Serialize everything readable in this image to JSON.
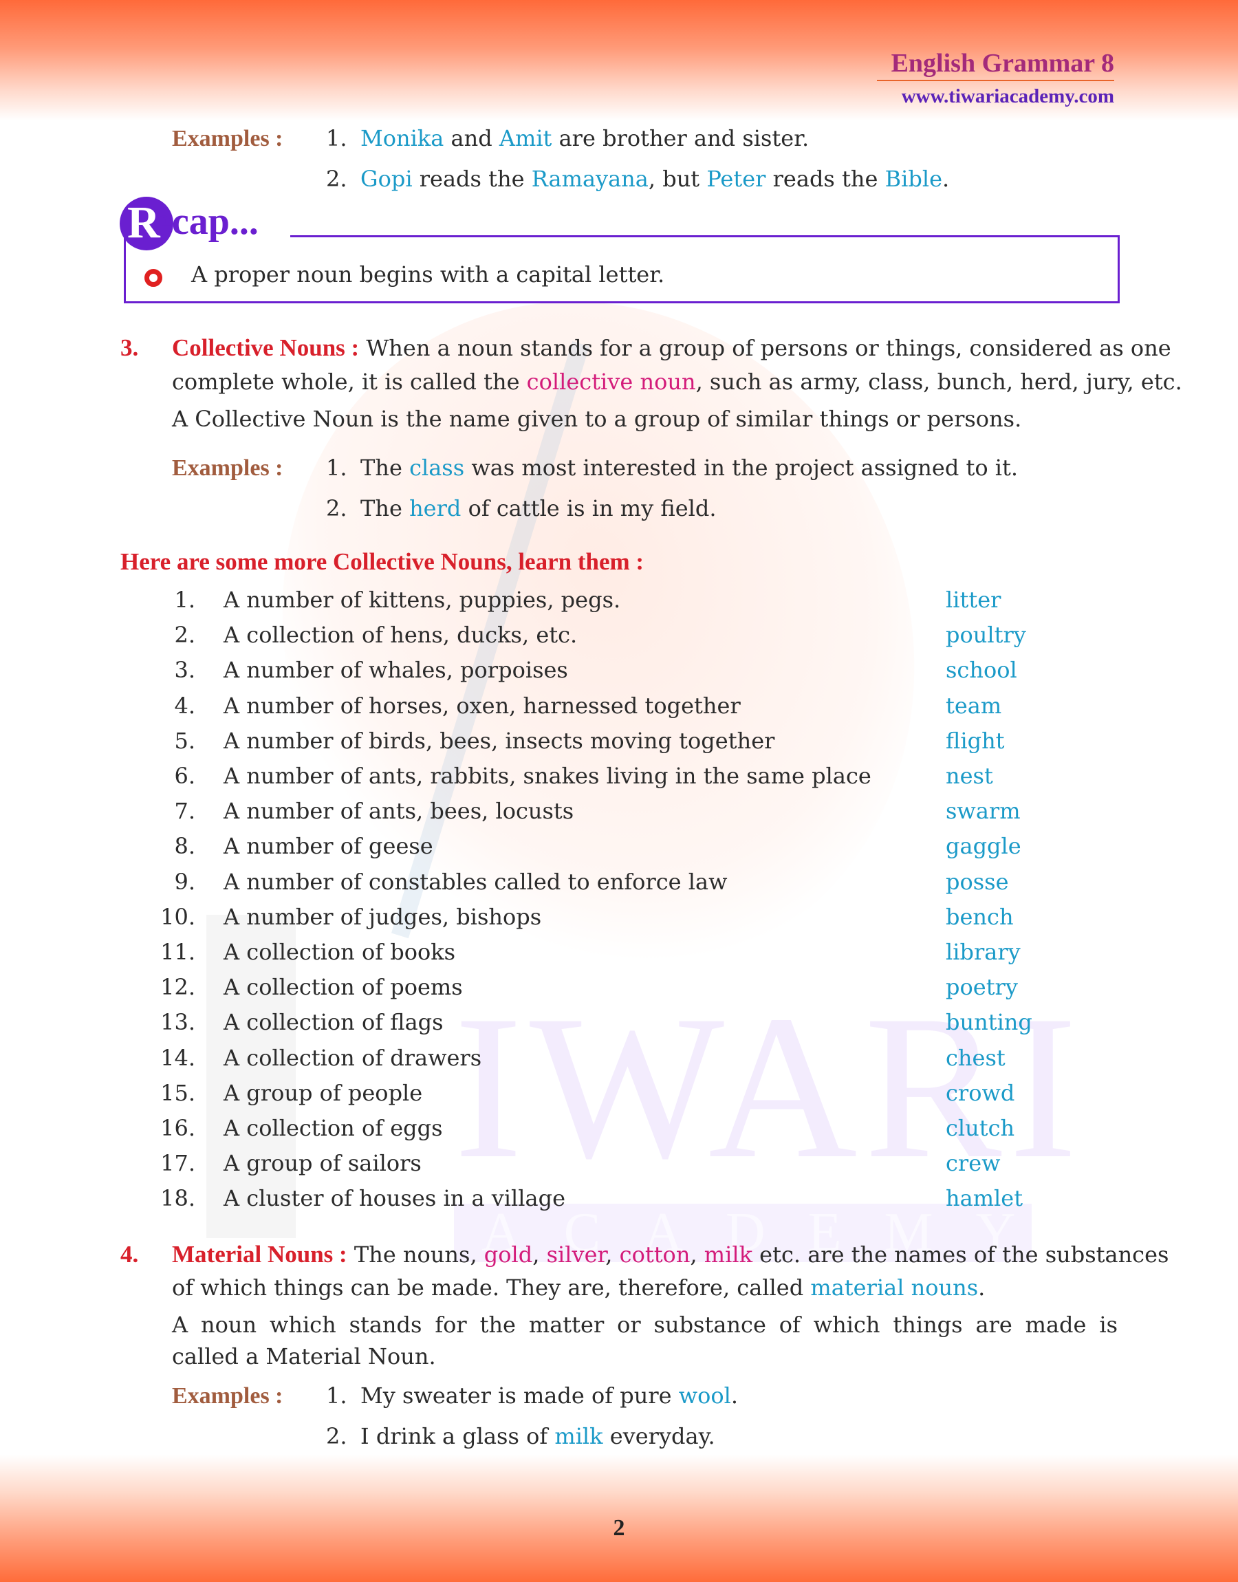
{
  "header": {
    "title": "English Grammar 8",
    "url": "www.tiwariacademy.com"
  },
  "proper_examples": {
    "label": "Examples :",
    "items": [
      {
        "num": "1.",
        "parts": [
          {
            "t": "Monika",
            "c": "blue"
          },
          {
            "t": " and ",
            "c": ""
          },
          {
            "t": "Amit",
            "c": "blue"
          },
          {
            "t": " are brother and sister.",
            "c": ""
          }
        ]
      },
      {
        "num": "2.",
        "parts": [
          {
            "t": "Gopi",
            "c": "blue"
          },
          {
            "t": " reads the ",
            "c": ""
          },
          {
            "t": "Ramayana",
            "c": "blue"
          },
          {
            "t": ", but ",
            "c": ""
          },
          {
            "t": "Peter",
            "c": "blue"
          },
          {
            "t": " reads the ",
            "c": ""
          },
          {
            "t": "Bible",
            "c": "blue"
          },
          {
            "t": ".",
            "c": ""
          }
        ]
      }
    ]
  },
  "recap": {
    "initial": "R",
    "rest": "ecap...",
    "points": [
      "A proper noun begins with a capital letter."
    ]
  },
  "section3": {
    "number": "3.",
    "heading": "Collective Nouns :",
    "line1": " When a noun stands for a group of persons or things, considered as one",
    "line2_parts": [
      {
        "t": "complete whole, it is called the ",
        "c": ""
      },
      {
        "t": "collective noun",
        "c": "pink"
      },
      {
        "t": ", such as army, class, bunch, herd, jury, etc.",
        "c": ""
      }
    ],
    "definition": "A Collective Noun is the name given to a group of similar things or persons.",
    "examples_label": "Examples :",
    "examples": [
      {
        "num": "1.",
        "parts": [
          {
            "t": "The ",
            "c": ""
          },
          {
            "t": "class",
            "c": "blue"
          },
          {
            "t": " was most interested in the project assigned to it.",
            "c": ""
          }
        ]
      },
      {
        "num": "2.",
        "parts": [
          {
            "t": "The ",
            "c": ""
          },
          {
            "t": "herd",
            "c": "blue"
          },
          {
            "t": " of cattle is in my field.",
            "c": ""
          }
        ]
      }
    ]
  },
  "more_collective": {
    "heading": "Here are some more Collective Nouns, learn them :",
    "items": [
      {
        "num": "1.",
        "text": "A number of kittens, puppies, pegs.",
        "answer": "litter"
      },
      {
        "num": "2.",
        "text": "A collection of hens, ducks, etc.",
        "answer": "poultry"
      },
      {
        "num": "3.",
        "text": "A number of whales, porpoises",
        "answer": "school"
      },
      {
        "num": "4.",
        "text": "A number of horses, oxen, harnessed together",
        "answer": "team"
      },
      {
        "num": "5.",
        "text": "A number of birds, bees, insects moving together",
        "answer": "flight"
      },
      {
        "num": "6.",
        "text": "A number of ants, rabbits, snakes living in the same place",
        "answer": "nest"
      },
      {
        "num": "7.",
        "text": "A number of ants, bees, locusts",
        "answer": "swarm"
      },
      {
        "num": "8.",
        "text": "A number of geese",
        "answer": "gaggle"
      },
      {
        "num": "9.",
        "text": "A number of constables called to enforce law",
        "answer": "posse"
      },
      {
        "num": "10.",
        "text": "A number of judges, bishops",
        "answer": "bench"
      },
      {
        "num": "11.",
        "text": "A collection of books",
        "answer": "library"
      },
      {
        "num": "12.",
        "text": "A collection of poems",
        "answer": "poetry"
      },
      {
        "num": "13.",
        "text": "A collection of flags",
        "answer": "bunting"
      },
      {
        "num": "14.",
        "text": "A collection of drawers",
        "answer": "chest"
      },
      {
        "num": "15.",
        "text": "A group of people",
        "answer": "crowd"
      },
      {
        "num": "16.",
        "text": "A collection of eggs",
        "answer": "clutch"
      },
      {
        "num": "17.",
        "text": "A group of sailors",
        "answer": "crew"
      },
      {
        "num": "18.",
        "text": "A cluster of houses in a village",
        "answer": "hamlet"
      }
    ]
  },
  "section4": {
    "number": "4.",
    "heading": "Material Nouns :",
    "line1_parts": [
      {
        "t": " The nouns, ",
        "c": ""
      },
      {
        "t": "gold",
        "c": "pink"
      },
      {
        "t": ", ",
        "c": ""
      },
      {
        "t": "silver",
        "c": "pink"
      },
      {
        "t": ", ",
        "c": ""
      },
      {
        "t": "cotton",
        "c": "pink"
      },
      {
        "t": ", ",
        "c": ""
      },
      {
        "t": "milk",
        "c": "pink"
      },
      {
        "t": " etc. are the names of the substances",
        "c": ""
      }
    ],
    "line2_parts": [
      {
        "t": "of which things can be made. They are, therefore, called ",
        "c": ""
      },
      {
        "t": "material nouns",
        "c": "blue"
      },
      {
        "t": ".",
        "c": ""
      }
    ],
    "definition_line1": "A noun which stands for the matter or substance of which things are made is",
    "definition_line2": "called a Material Noun.",
    "examples_label": "Examples :",
    "examples": [
      {
        "num": "1.",
        "parts": [
          {
            "t": "My sweater is made of pure ",
            "c": ""
          },
          {
            "t": "wool",
            "c": "blue"
          },
          {
            "t": ".",
            "c": ""
          }
        ]
      },
      {
        "num": "2.",
        "parts": [
          {
            "t": "I drink a glass of ",
            "c": ""
          },
          {
            "t": "milk",
            "c": "blue"
          },
          {
            "t": " everyday.",
            "c": ""
          }
        ]
      }
    ]
  },
  "watermark": {
    "big": "IWARI",
    "small": "ACADEMY"
  },
  "footer": {
    "page_number": "2"
  }
}
